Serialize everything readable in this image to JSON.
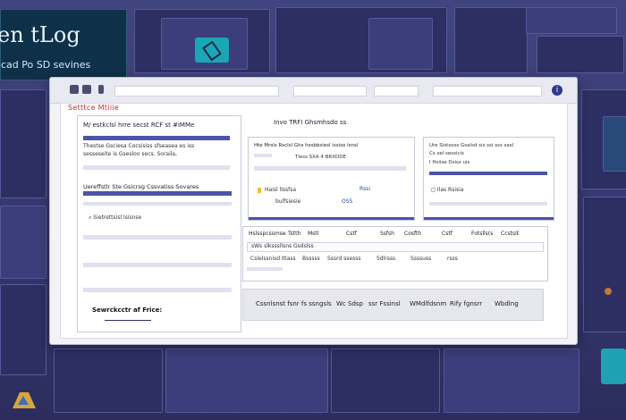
{
  "background": {
    "hero_title": "en tLog",
    "hero_subtitle": "cad Po SD sevines"
  },
  "window": {
    "info_icon": "i",
    "section_title": "Setttce Mtiiie"
  },
  "left_panel": {
    "header": "M/ estkclsl hrre secst RCF st #iMMe",
    "desc": [
      "Thestse Gsciesa Cocsisiss sfseasea es  iss",
      "sesseseite is Gsesloo secs. Soraila,"
    ],
    "subheader": "Uereffstlr Ste Gsicrsg Cssvatiss Sovares",
    "item": "Sietrettsisl lsisnse",
    "search_label": "Sewrckcctr af Frice:"
  },
  "middle_card": {
    "header": "Invo TRFI Ghsmhsdo ss",
    "line": "Hte Mrsls Rsclsl Ghs hssbbsiesl issiso lsnsl",
    "sub": "Tiess  SXA 4 BRXDDE",
    "items": [
      "Haisl llssfsa",
      "bulfsiesie"
    ],
    "tags": [
      "Rssi",
      "OSS"
    ]
  },
  "right_card": {
    "line1": "Ure Sistosss Gsalsd sis ssi sss sasl",
    "line2": "Cs sel sessicis",
    "line3": "I Hsiise Dsiss uis",
    "item": "Ilas Rsisia"
  },
  "table": {
    "headers": [
      "Hslsspcssmse",
      "Tstth",
      "Mstl",
      "Cstf",
      "Ssfsh",
      "Cosfth",
      "Cstf",
      "Fotslls(s",
      "Ccstsit"
    ],
    "row1": "sWs slksssllsns Gsdslss",
    "row2": [
      "Cslelssnisd Itlass",
      "Bsssss",
      "Sssrd ssesss",
      "Sdlrsss",
      "Ssssuss",
      "rsss"
    ]
  },
  "footer_tabs": [
    "Cssnlsnst fsnr fs ssngsls",
    "Wc Sdsp",
    "ssr Fssinsl",
    "WMdlfdsnm",
    "Rify fgnsrr",
    "Wbdlng"
  ]
}
